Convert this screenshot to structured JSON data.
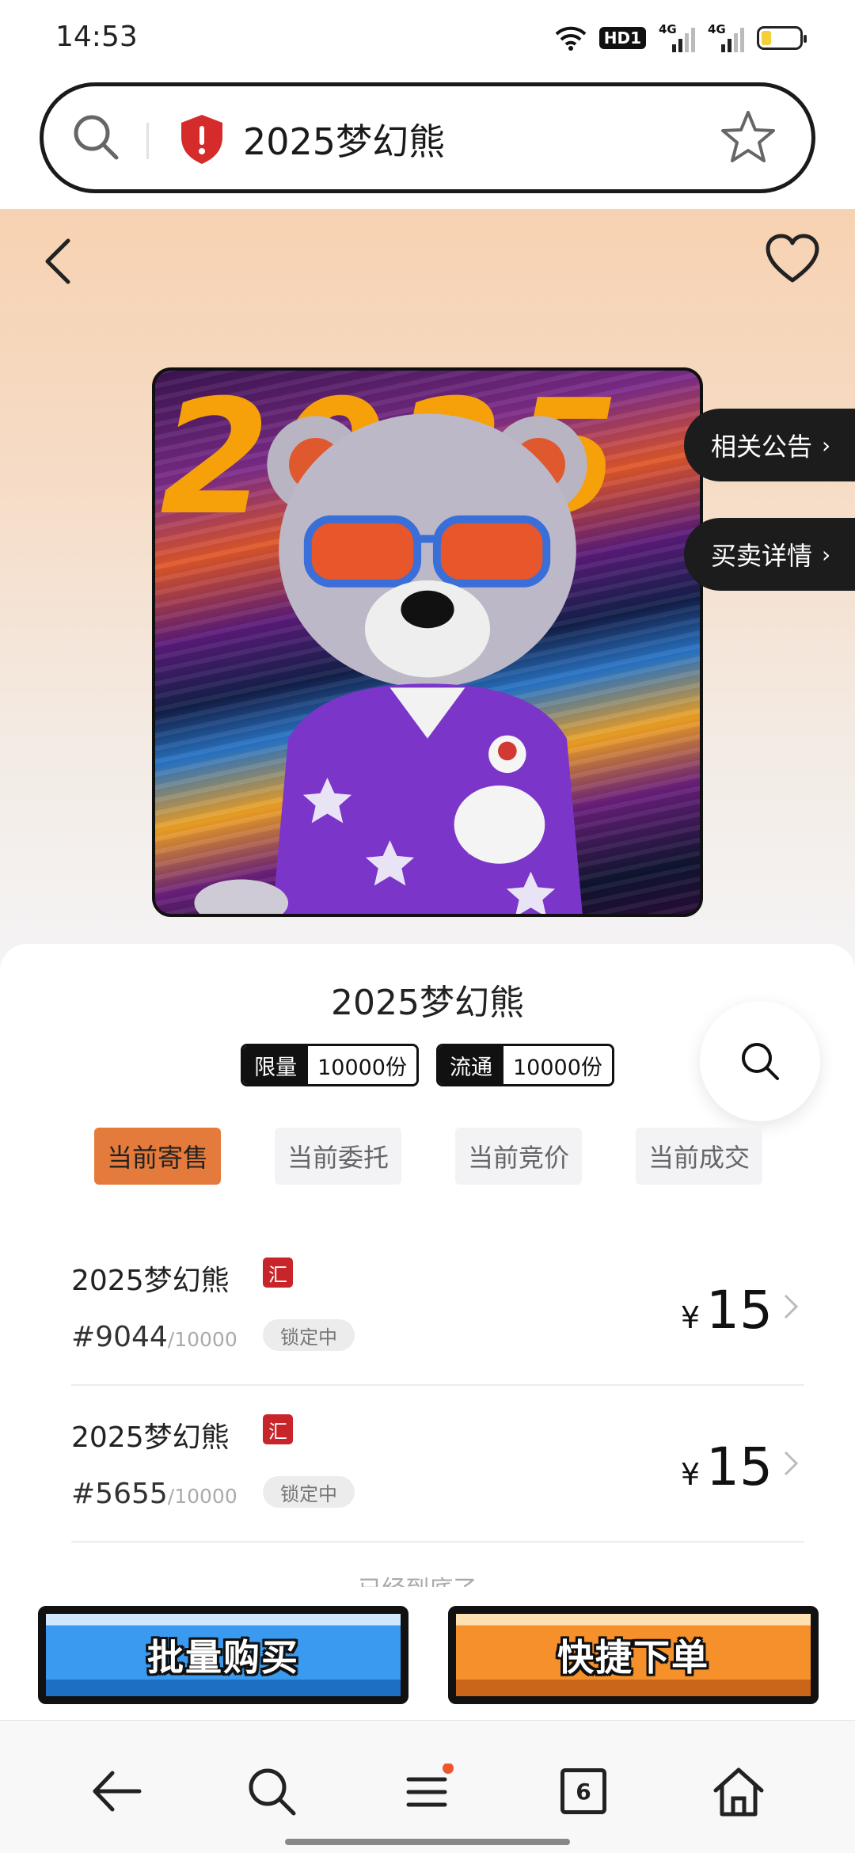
{
  "status": {
    "time": "14:53",
    "hd": "HD1",
    "net1": "4G",
    "net2": "4G",
    "battery_percent": 25
  },
  "search": {
    "query": "2025梦幻熊"
  },
  "hero": {
    "artwork_year_text": "2025",
    "side_links": [
      {
        "label": "相关公告"
      },
      {
        "label": "买卖详情"
      }
    ]
  },
  "product": {
    "title": "2025梦幻熊",
    "tags": [
      {
        "key": "限量",
        "value": "10000份"
      },
      {
        "key": "流通",
        "value": "10000份"
      }
    ]
  },
  "tabs": [
    {
      "label": "当前寄售",
      "active": true
    },
    {
      "label": "当前委托",
      "active": false
    },
    {
      "label": "当前竞价",
      "active": false
    },
    {
      "label": "当前成交",
      "active": false
    }
  ],
  "listings": [
    {
      "name": "2025梦幻熊",
      "badge": "汇",
      "serial": "#9044",
      "total": "/10000",
      "status": "锁定中",
      "currency": "¥",
      "price": "15"
    },
    {
      "name": "2025梦幻熊",
      "badge": "汇",
      "serial": "#5655",
      "total": "/10000",
      "status": "锁定中",
      "currency": "¥",
      "price": "15"
    }
  ],
  "end_text": "已经到底了~",
  "actions": {
    "batch_buy": "批量购买",
    "quick_order": "快捷下单"
  },
  "nav": {
    "tab_count": "6"
  },
  "colors": {
    "accent_orange": "#e47a3b",
    "badge_red": "#c8252b",
    "button_blue": "#3a9af0",
    "button_orange": "#f5902a"
  }
}
